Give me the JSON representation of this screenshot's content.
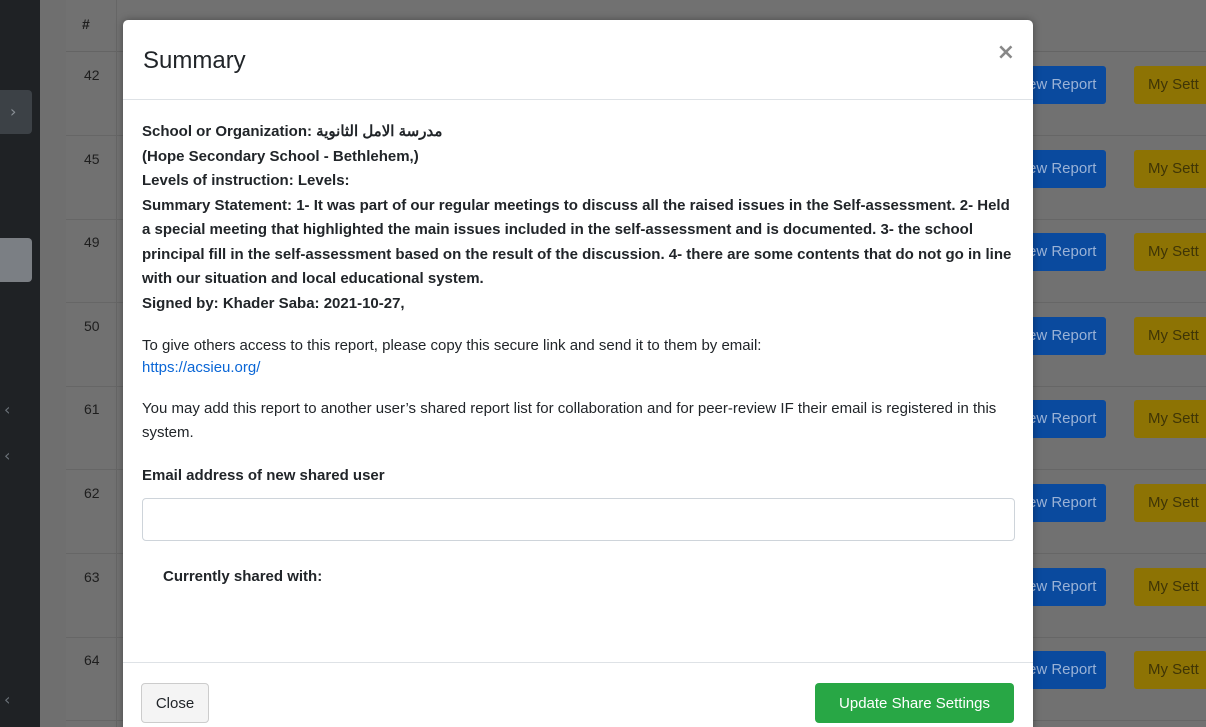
{
  "background": {
    "table_header": {
      "sort_col": "#"
    },
    "rows": [
      {
        "id": "42",
        "view_label": "ew Report",
        "settings_label": "My Sett"
      },
      {
        "id": "45",
        "view_label": "ew Report",
        "settings_label": "My Sett"
      },
      {
        "id": "49",
        "view_label": "ew Report",
        "settings_label": "My Sett"
      },
      {
        "id": "50",
        "view_label": "ew Report",
        "settings_label": "My Sett"
      },
      {
        "id": "61",
        "view_label": "ew Report",
        "settings_label": "My Sett"
      },
      {
        "id": "62",
        "view_label": "ew Report",
        "settings_label": "My Sett"
      },
      {
        "id": "63",
        "view_label": "ew Report",
        "settings_label": "My Sett"
      },
      {
        "id": "64",
        "view_label": "ew Report",
        "settings_label": "My Sett"
      }
    ]
  },
  "modal": {
    "title": "Summary",
    "close_icon": "×",
    "summary": {
      "school_line": "School or Organization: مدرسة الامل الثانوية",
      "school_alt": "(Hope Secondary School - Bethlehem,)",
      "levels": "Levels of instruction: Levels:",
      "statement": "Summary Statement: 1- It was part of our regular meetings to discuss all the raised issues in the Self-assessment. 2- Held a special meeting that highlighted the main issues included in the self-assessment and is documented. 3- the school principal fill in the self-assessment based on the result of the discussion. 4- there are some contents that do not go in line with our situation and local educational system.",
      "signed": "Signed by: Khader Saba: 2021-10-27,"
    },
    "share_info": "To give others access to this report, please copy this secure link and send it to them by email:",
    "share_link": "https://acsieu.org/",
    "collab_info": "You may add this report to another user’s shared report list for collaboration and for peer-review IF their email is registered in this system.",
    "email_label": "Email address of new shared user",
    "email_value": "",
    "shared_with_label": "Currently shared with:",
    "close_button": "Close",
    "update_button": "Update Share Settings"
  },
  "colors": {
    "primary": "#0a66d6",
    "success": "#28a745",
    "warning": "#8d7304"
  }
}
